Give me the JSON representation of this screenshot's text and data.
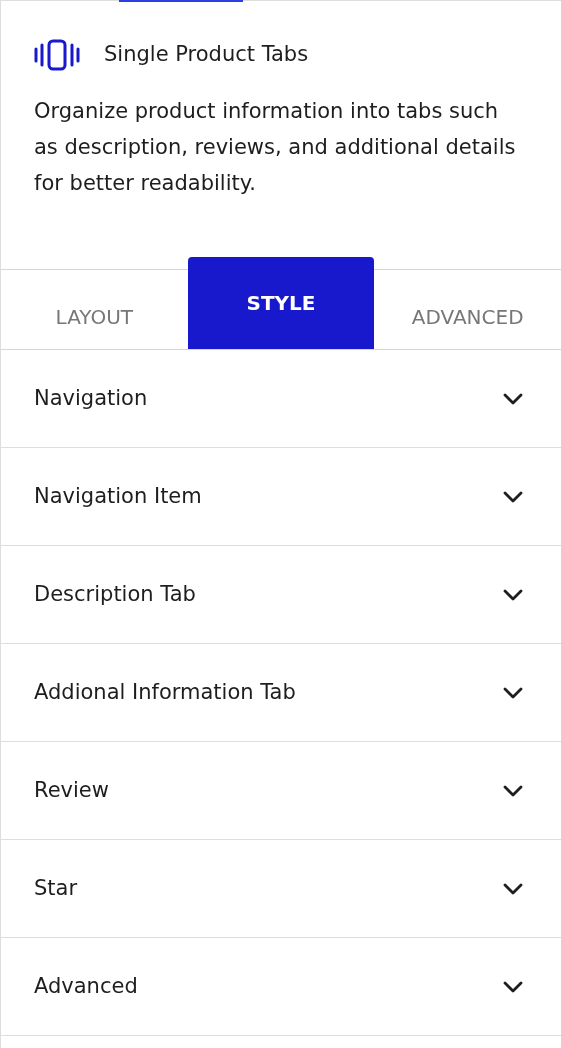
{
  "widget": {
    "title": "Single Product Tabs",
    "description": "Organize product information into tabs such as description, reviews, and additional details for better readability."
  },
  "tabs": [
    {
      "label": "LAYOUT",
      "selected": false
    },
    {
      "label": "STYLE",
      "selected": true
    },
    {
      "label": "ADVANCED",
      "selected": false
    }
  ],
  "sections": [
    {
      "label": "Navigation",
      "expanded": false
    },
    {
      "label": "Navigation Item",
      "expanded": false
    },
    {
      "label": "Description Tab",
      "expanded": false
    },
    {
      "label": "Addional Information Tab",
      "expanded": false
    },
    {
      "label": "Review",
      "expanded": false
    },
    {
      "label": "Star",
      "expanded": false
    },
    {
      "label": "Advanced",
      "expanded": false
    }
  ]
}
